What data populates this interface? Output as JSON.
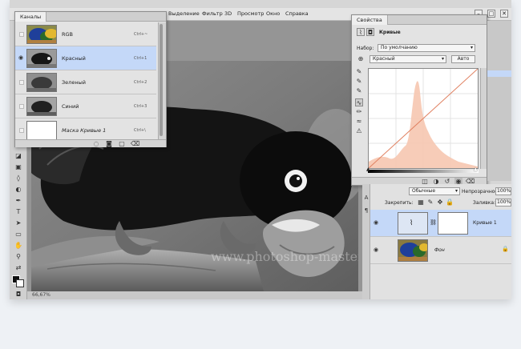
{
  "menu": {
    "items": [
      "Выделение",
      "Фильтр",
      "3D",
      "Просмотр",
      "Окно",
      "Справка"
    ],
    "win_minimize": "–",
    "win_restore": "□",
    "win_close": "✕"
  },
  "channels_panel": {
    "tab": "Каналы",
    "rows": [
      {
        "name": "RGB",
        "key": "Ctrl+~",
        "visible": true,
        "selected": false
      },
      {
        "name": "Красный",
        "key": "Ctrl+1",
        "visible": true,
        "selected": true
      },
      {
        "name": "Зеленый",
        "key": "Ctrl+2",
        "visible": false,
        "selected": false
      },
      {
        "name": "Синий",
        "key": "Ctrl+3",
        "visible": false,
        "selected": false
      },
      {
        "name": "Маска Кривые 1",
        "key": "Ctrl+\\",
        "visible": false,
        "selected": false
      }
    ]
  },
  "properties_panel": {
    "tab": "Свойства",
    "adjustment": "Кривые",
    "preset_label": "Набор:",
    "preset_value": "По умолчанию",
    "channel_value": "Красный",
    "auto_button": "Авто"
  },
  "layers_panel": {
    "blend_mode": "Обычные",
    "opacity_label": "Непрозрачность:",
    "opacity_value": "100%",
    "lock_label": "Закрепить:",
    "fill_label": "Заливка:",
    "fill_value": "100%",
    "layers": [
      {
        "name": "Кривые 1",
        "selected": true
      },
      {
        "name": "Фон",
        "selected": false
      }
    ]
  },
  "canvas": {
    "watermark": "www.photoshop-master.ru"
  },
  "status_bar": {
    "zoom": "66,67%"
  },
  "icons": {
    "eye": "eye-icon",
    "curves": "curves-icon",
    "mask": "mask-icon",
    "lock": "lock-icon"
  }
}
